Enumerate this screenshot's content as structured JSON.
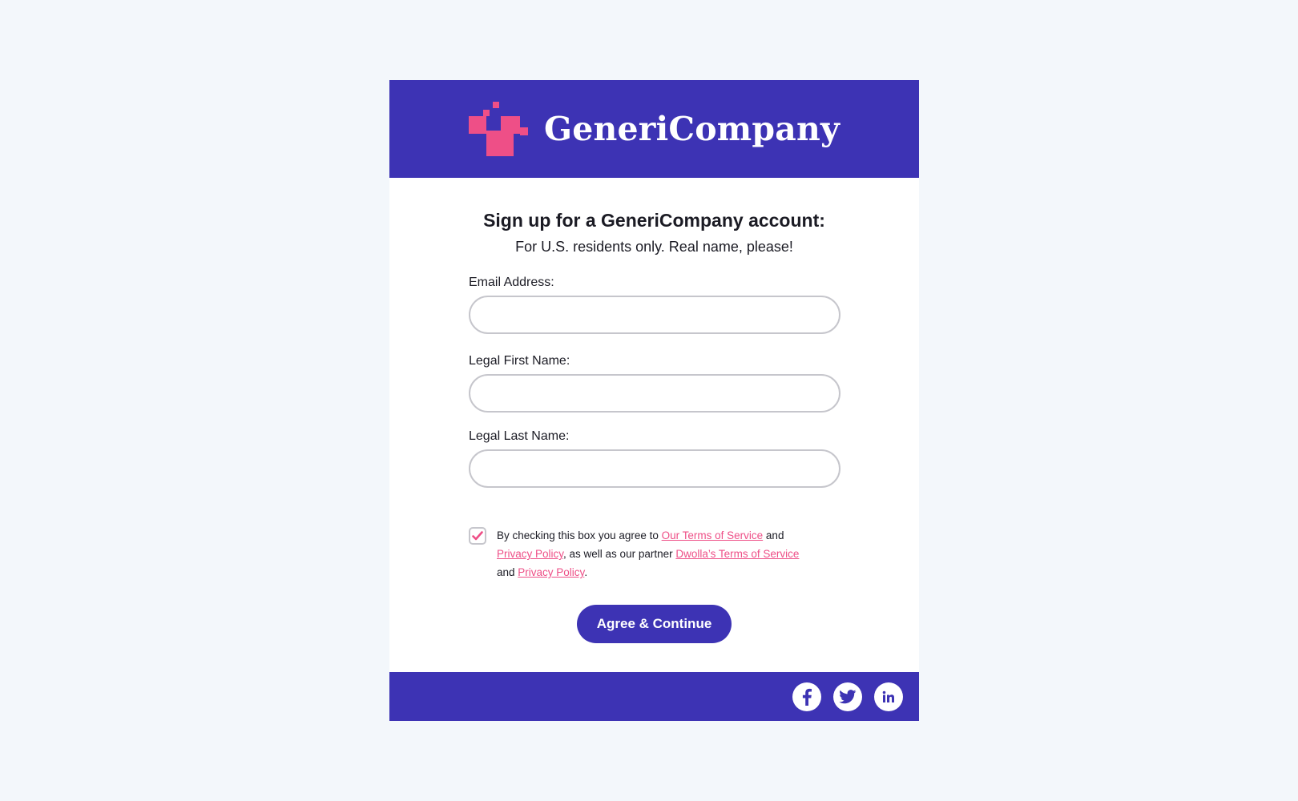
{
  "brand": {
    "name": "GeneriCompany",
    "logo_icon": "pixel-squares-logo-icon",
    "colors": {
      "primary": "#3d33b4",
      "accent": "#ee4f87",
      "background": "#f3f7fb"
    }
  },
  "form": {
    "title": "Sign up for a GeneriCompany account:",
    "subtitle": "For U.S. residents only. Real name, please!",
    "fields": [
      {
        "label": "Email Address:",
        "value": "",
        "placeholder": ""
      },
      {
        "label": "Legal First Name:",
        "value": "",
        "placeholder": ""
      },
      {
        "label": "Legal Last Name:",
        "value": "",
        "placeholder": ""
      }
    ],
    "terms": {
      "checked": true,
      "text_1": "By checking this box you agree to ",
      "link_1": "Our Terms of Service",
      "text_2": " and ",
      "link_2": "Privacy Policy",
      "text_3": ", as well as our partner ",
      "link_3": "Dwolla’s Terms of Service",
      "text_4": " and ",
      "link_4": "Privacy Policy",
      "text_5": "."
    },
    "submit_label": "Agree & Continue"
  },
  "footer": {
    "social": [
      {
        "icon": "facebook-icon"
      },
      {
        "icon": "twitter-icon"
      },
      {
        "icon": "linkedin-icon"
      }
    ]
  }
}
